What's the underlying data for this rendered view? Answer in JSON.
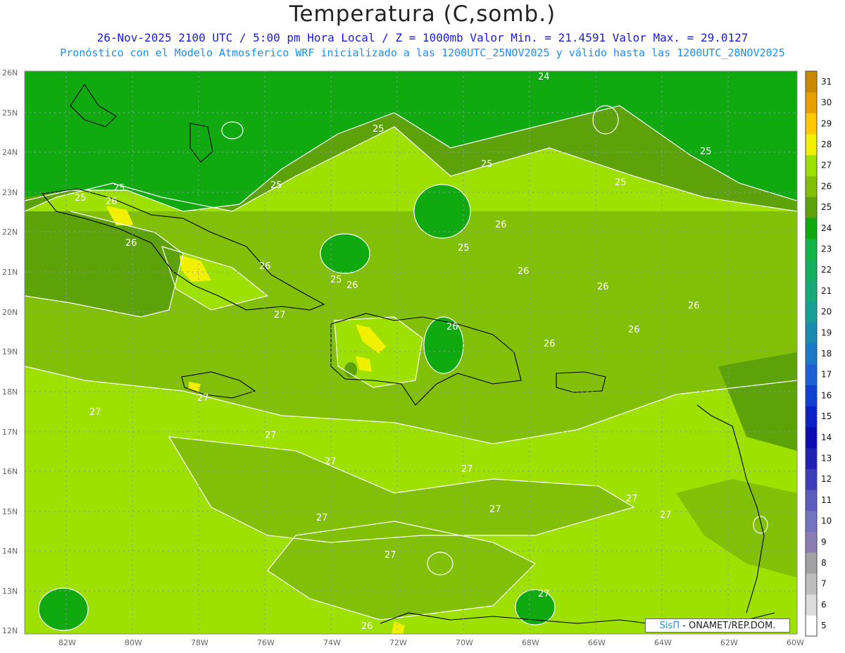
{
  "title": "Temperatura (C,somb.)",
  "subtitle1": "26-Nov-2025  2100 UTC / 5:00 pm Hora Local / Z = 1000mb   Valor Min. = 21.4591  Valor Max. = 29.0127",
  "subtitle2": "Pronóstico con el Modelo Atmosferico WRF inicializado a las 1200UTC_25NOV2025 y válido hasta las  1200UTC_28NOV2025",
  "credit": {
    "brand": "SisΠ",
    "rest": " - ONAMET/REP.DOM."
  },
  "map": {
    "lon_range": [
      -83.2,
      -60
    ],
    "lat_range": [
      11.9,
      26.0
    ],
    "x_ticks": [
      "82W",
      "80W",
      "78W",
      "76W",
      "74W",
      "72W",
      "70W",
      "68W",
      "66W",
      "64W",
      "62W",
      "60W"
    ],
    "y_ticks": [
      "26N",
      "25N",
      "24N",
      "23N",
      "22N",
      "21N",
      "20N",
      "19N",
      "18N",
      "17N",
      "16N",
      "15N",
      "14N",
      "13N",
      "12N"
    ],
    "contour_labels": [
      "24",
      "25",
      "25",
      "25",
      "25",
      "25",
      "25",
      "25",
      "25",
      "25",
      "26",
      "26",
      "26",
      "26",
      "26",
      "26",
      "26",
      "26",
      "26",
      "26",
      "26",
      "27",
      "27",
      "27",
      "27",
      "27",
      "27",
      "27",
      "27",
      "27",
      "27",
      "27",
      "27",
      "26"
    ]
  },
  "colorbar": {
    "levels": [
      "5",
      "6",
      "7",
      "8",
      "9",
      "10",
      "11",
      "12",
      "13",
      "14",
      "15",
      "16",
      "17",
      "18",
      "19",
      "20",
      "21",
      "22",
      "23",
      "24",
      "25",
      "26",
      "27",
      "28",
      "29",
      "30",
      "31"
    ],
    "colors": [
      "#ffffff",
      "#dcdcdc",
      "#bebebe",
      "#a2a2a2",
      "#8c7cb4",
      "#7474c0",
      "#5c5cbe",
      "#3c3cba",
      "#2020b4",
      "#0c0cb4",
      "#0a20c8",
      "#1040d0",
      "#1c60d4",
      "#1c78c8",
      "#1a8cb0",
      "#18a096",
      "#16ab78",
      "#14b25e",
      "#12b646",
      "#10aa10",
      "#5ea20a",
      "#82c008",
      "#9ee000",
      "#f0f000",
      "#ffc800",
      "#e8a000",
      "#c88800"
    ]
  }
}
